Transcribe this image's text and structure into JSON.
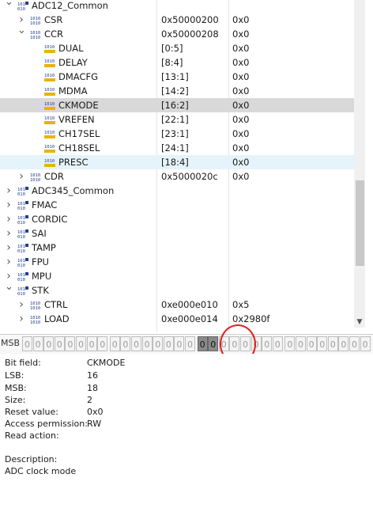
{
  "tree": {
    "rows": [
      {
        "label": "ADC12_Common",
        "addr": "",
        "val": "",
        "arrow": "open",
        "icon": "peripheral-icon"
      },
      {
        "label": "CSR",
        "addr": "0x50000200",
        "val": "0x0",
        "arrow": "closed",
        "icon": "register-icon"
      },
      {
        "label": "CCR",
        "addr": "0x50000208",
        "val": "0x0",
        "arrow": "open",
        "icon": "register-icon"
      },
      {
        "label": "DUAL",
        "addr": "[0:5]",
        "val": "0x0",
        "arrow": "none",
        "icon": "field-icon"
      },
      {
        "label": "DELAY",
        "addr": "[8:4]",
        "val": "0x0",
        "arrow": "none",
        "icon": "field-icon"
      },
      {
        "label": "DMACFG",
        "addr": "[13:1]",
        "val": "0x0",
        "arrow": "none",
        "icon": "field-icon"
      },
      {
        "label": "MDMA",
        "addr": "[14:2]",
        "val": "0x0",
        "arrow": "none",
        "icon": "field-icon"
      },
      {
        "label": "CKMODE",
        "addr": "[16:2]",
        "val": "0x0",
        "arrow": "none",
        "icon": "field-icon"
      },
      {
        "label": "VREFEN",
        "addr": "[22:1]",
        "val": "0x0",
        "arrow": "none",
        "icon": "field-icon"
      },
      {
        "label": "CH17SEL",
        "addr": "[23:1]",
        "val": "0x0",
        "arrow": "none",
        "icon": "field-icon"
      },
      {
        "label": "CH18SEL",
        "addr": "[24:1]",
        "val": "0x0",
        "arrow": "none",
        "icon": "field-icon"
      },
      {
        "label": "PRESC",
        "addr": "[18:4]",
        "val": "0x0",
        "arrow": "none",
        "icon": "field-icon"
      },
      {
        "label": "CDR",
        "addr": "0x5000020c",
        "val": "0x0",
        "arrow": "closed",
        "icon": "register-icon"
      },
      {
        "label": "ADC345_Common",
        "addr": "",
        "val": "",
        "arrow": "closed",
        "icon": "peripheral-icon"
      },
      {
        "label": "FMAC",
        "addr": "",
        "val": "",
        "arrow": "closed",
        "icon": "peripheral-icon"
      },
      {
        "label": "CORDIC",
        "addr": "",
        "val": "",
        "arrow": "closed",
        "icon": "peripheral-icon"
      },
      {
        "label": "SAI",
        "addr": "",
        "val": "",
        "arrow": "closed",
        "icon": "peripheral-icon"
      },
      {
        "label": "TAMP",
        "addr": "",
        "val": "",
        "arrow": "closed",
        "icon": "peripheral-icon"
      },
      {
        "label": "FPU",
        "addr": "",
        "val": "",
        "arrow": "closed",
        "icon": "peripheral-icon"
      },
      {
        "label": "MPU",
        "addr": "",
        "val": "",
        "arrow": "closed",
        "icon": "peripheral-icon"
      },
      {
        "label": "STK",
        "addr": "",
        "val": "",
        "arrow": "open",
        "icon": "peripheral-icon"
      },
      {
        "label": "CTRL",
        "addr": "0xe000e010",
        "val": "0x5",
        "arrow": "closed",
        "icon": "register-icon"
      },
      {
        "label": "LOAD",
        "addr": "0xe000e014",
        "val": "0x2980f",
        "arrow": "closed",
        "icon": "register-icon"
      }
    ]
  },
  "bitbar": {
    "msb_label": "MSB",
    "bits": [
      "0",
      "0",
      "0",
      "0",
      "0",
      "0",
      "0",
      "0",
      "0",
      "0",
      "0",
      "0",
      "0",
      "0",
      "0",
      "0",
      "0",
      "0",
      "0",
      "0",
      "0",
      "0",
      "0",
      "0",
      "0",
      "0",
      "0",
      "0",
      "0",
      "0",
      "0",
      "0"
    ],
    "highlighted": [
      16,
      17
    ]
  },
  "detail": {
    "bit_field_label": "Bit field:",
    "bit_field": "CKMODE",
    "lsb_label": "LSB:",
    "lsb": "16",
    "msb_label": "MSB:",
    "msb": "18",
    "size_label": "Size:",
    "size": "2",
    "reset_label": "Reset value:",
    "reset": "0x0",
    "access_label": "Access permission:",
    "access": "RW",
    "read_action_label": "Read action:",
    "description_label": "Description:",
    "description": "ADC clock mode"
  },
  "colors": {
    "selected_row": "#d9d9d9",
    "hover_row": "#e5f3fb",
    "annotation": "#e02020"
  }
}
